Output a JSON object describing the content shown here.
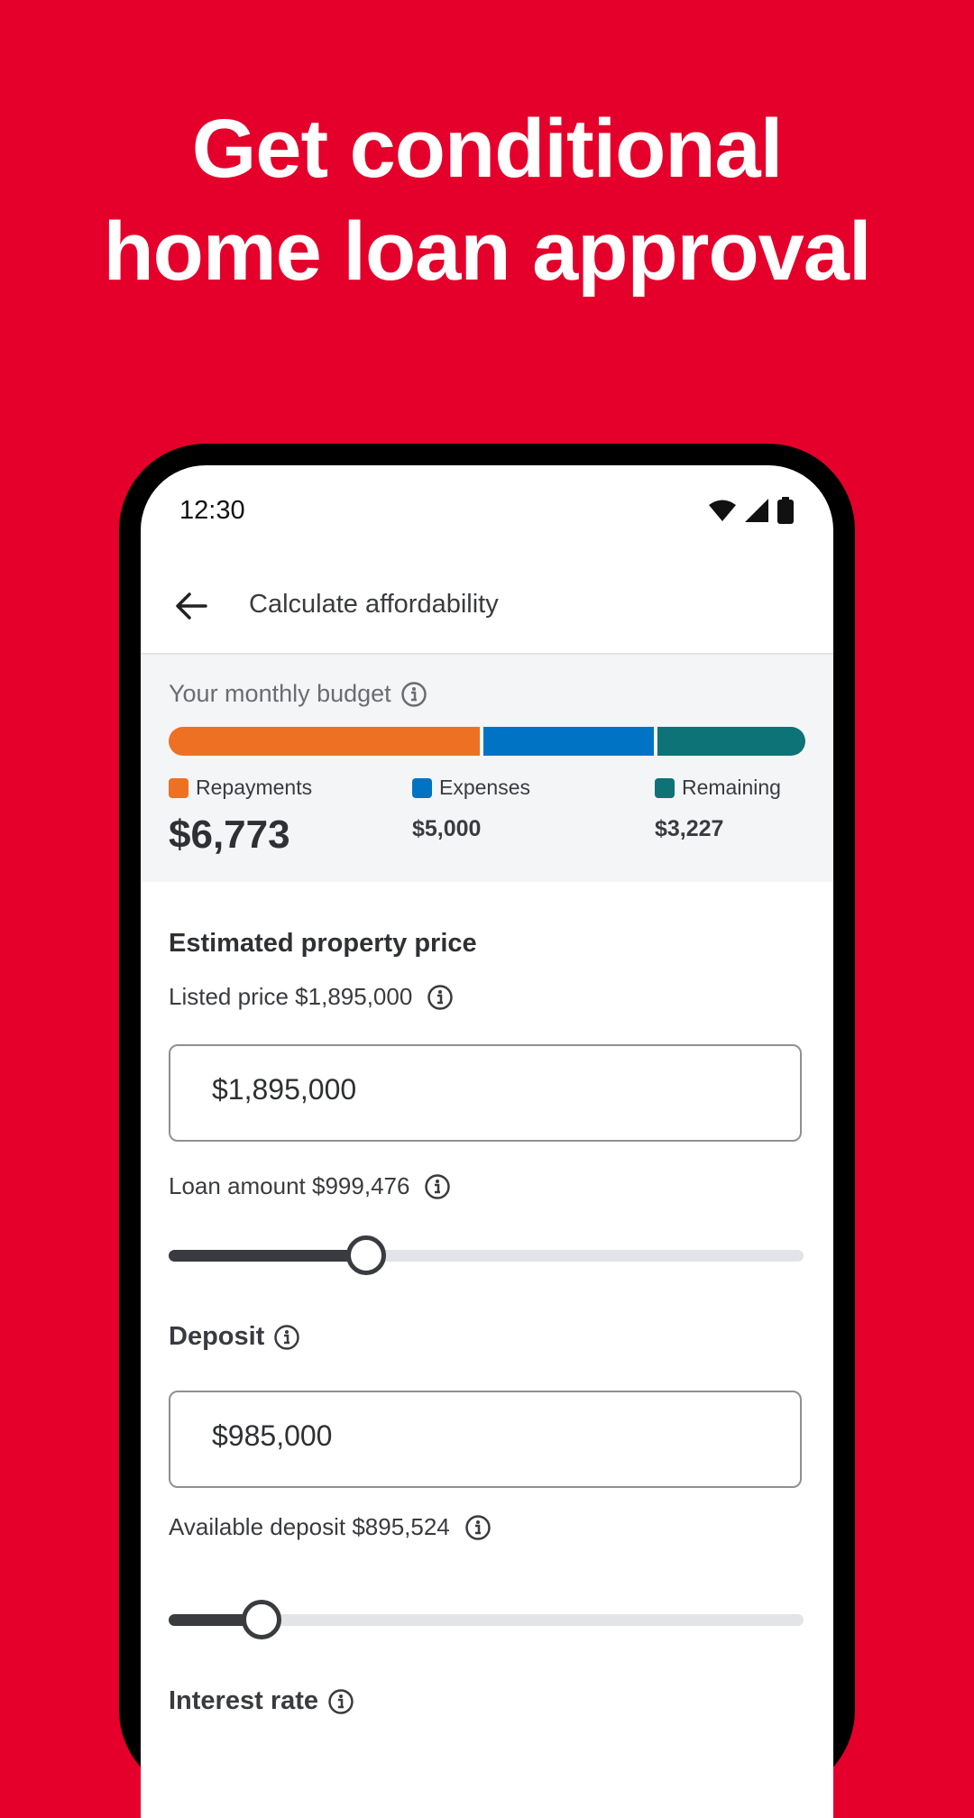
{
  "headline": {
    "line1": "Get conditional",
    "line2": "home loan approval"
  },
  "colors": {
    "brand_red": "#e4002b",
    "repayments": "#ee7023",
    "expenses": "#0073c4",
    "remaining": "#0d7377"
  },
  "status": {
    "time": "12:30",
    "icons": [
      "wifi-icon",
      "signal-icon",
      "battery-icon"
    ]
  },
  "appbar": {
    "title": "Calculate affordability",
    "back_icon": "arrow-left-icon"
  },
  "budget": {
    "label": "Your monthly budget",
    "segments": [
      {
        "name": "Repayments",
        "value": "$6,773",
        "amount": 6773
      },
      {
        "name": "Expenses",
        "value": "$5,000",
        "amount": 5000
      },
      {
        "name": "Remaining",
        "value": "$3,227",
        "amount": 3227
      }
    ]
  },
  "property": {
    "title": "Estimated property price",
    "listed_label": "Listed price $1,895,000",
    "price_value": "$1,895,000",
    "loan_label": "Loan amount $999,476",
    "loan_slider_fraction": 0.31
  },
  "deposit": {
    "title": "Deposit",
    "value": "$985,000",
    "available_label": "Available deposit $895,524",
    "slider_fraction": 0.145
  },
  "interest": {
    "title": "Interest rate"
  }
}
